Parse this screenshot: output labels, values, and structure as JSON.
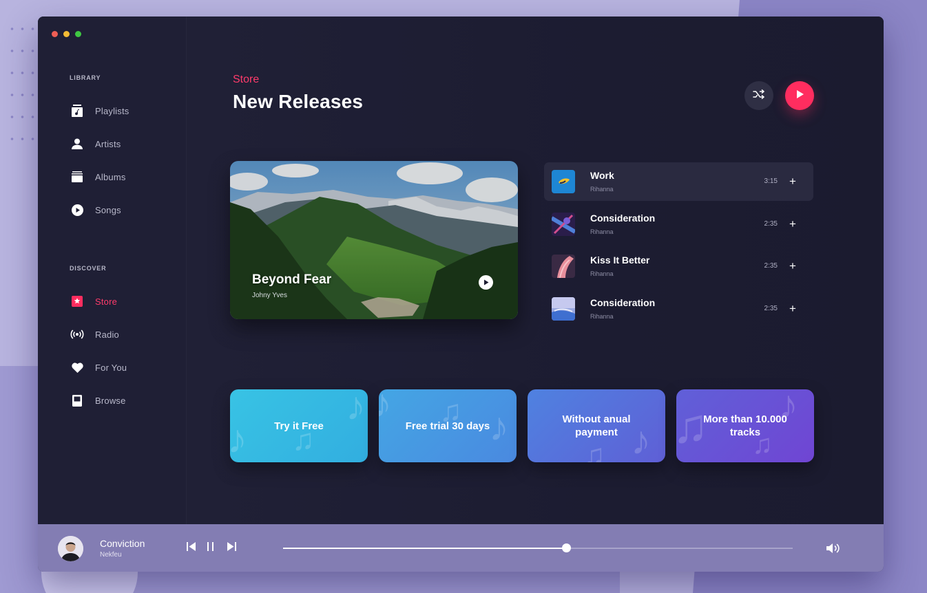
{
  "sidebar": {
    "library_title": "LIBRARY",
    "library_items": [
      {
        "label": "Playlists",
        "icon": "playlist-icon"
      },
      {
        "label": "Artists",
        "icon": "user-icon"
      },
      {
        "label": "Albums",
        "icon": "albums-icon"
      },
      {
        "label": "Songs",
        "icon": "play-circle-icon"
      }
    ],
    "discover_title": "DISCOVER",
    "discover_items": [
      {
        "label": "Store",
        "icon": "star-badge-icon",
        "active": true
      },
      {
        "label": "Radio",
        "icon": "radio-icon"
      },
      {
        "label": "For You",
        "icon": "heart-icon"
      },
      {
        "label": "Browse",
        "icon": "browse-icon"
      }
    ]
  },
  "header": {
    "breadcrumb": "Store",
    "title": "New Releases"
  },
  "hero": {
    "title": "Beyond Fear",
    "artist": "Johny Yves"
  },
  "tracks": [
    {
      "title": "Work",
      "artist": "Rihanna",
      "duration": "3:15",
      "active": true
    },
    {
      "title": "Consideration",
      "artist": "Rihanna",
      "duration": "2:35"
    },
    {
      "title": "Kiss It Better",
      "artist": "Rihanna",
      "duration": "2:35"
    },
    {
      "title": "Consideration",
      "artist": "Rihanna",
      "duration": "2:35"
    }
  ],
  "add_glyph": "+",
  "promos": [
    {
      "text": "Try it Free"
    },
    {
      "text": "Free trial 30 days"
    },
    {
      "text": "Without anual payment"
    },
    {
      "text": "More than 10.000 tracks"
    }
  ],
  "player": {
    "title": "Conviction",
    "artist": "Nekfeu",
    "progress": 0.555
  },
  "colors": {
    "accent": "#ff2d5f",
    "window_bg": "#1c1c31",
    "promo_1": "#36bde2",
    "promo_2": "#4896e2",
    "promo_3": "#5b6cd9",
    "promo_4": "#6c4fd6"
  }
}
